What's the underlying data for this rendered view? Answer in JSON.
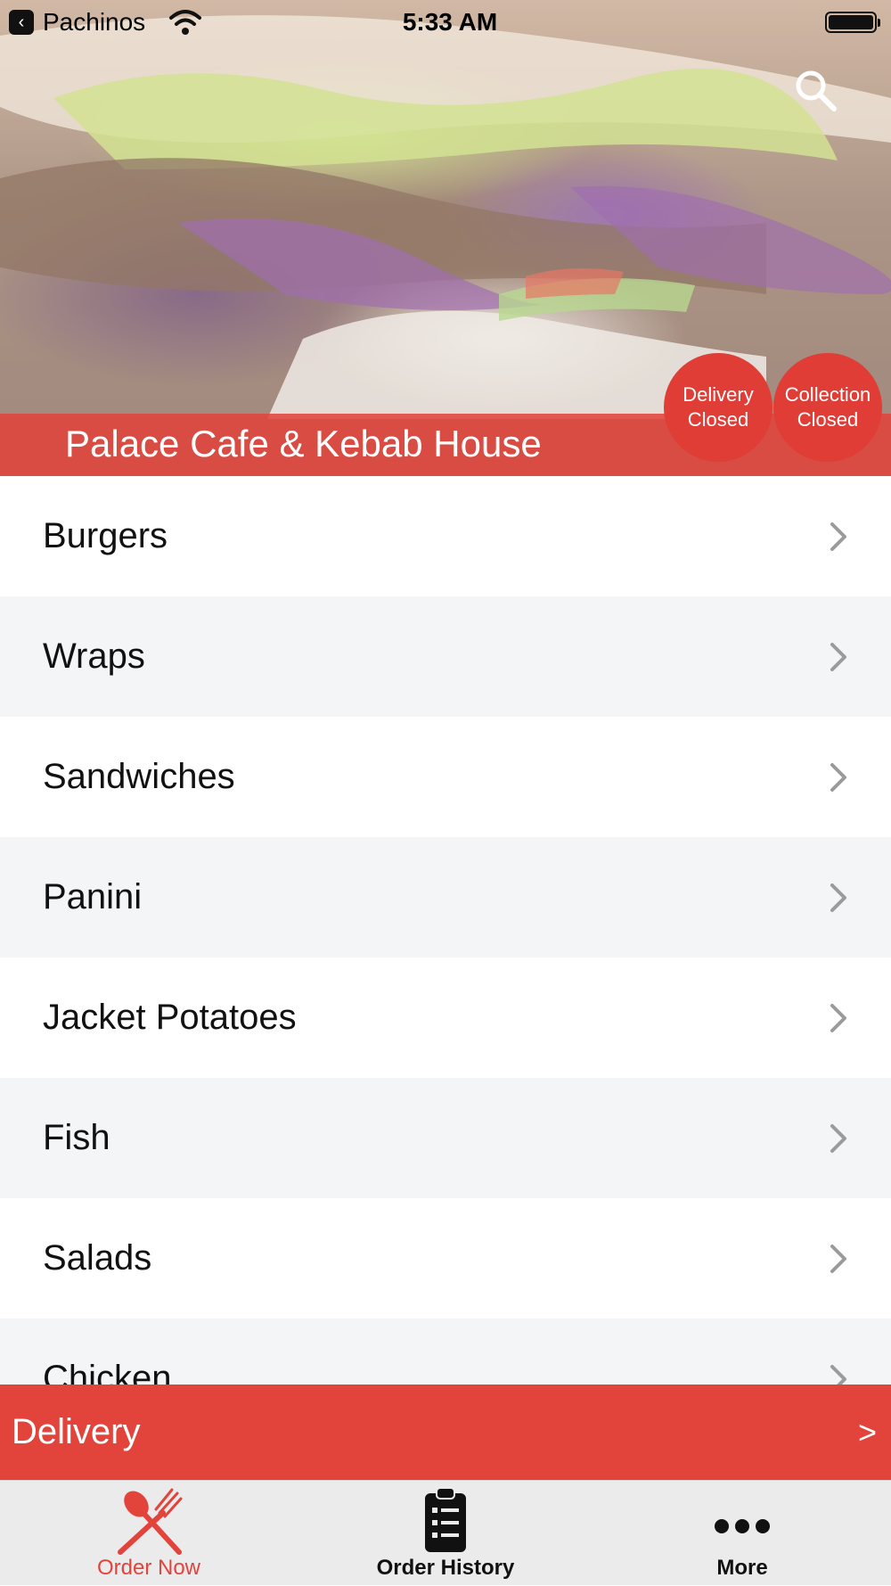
{
  "status_bar": {
    "back_app": "Pachinos",
    "time": "5:33 AM"
  },
  "header": {
    "restaurant_name": "Palace Cafe & Kebab House",
    "delivery_status_line1": "Delivery",
    "delivery_status_line2": "Closed",
    "collection_status_line1": "Collection",
    "collection_status_line2": "Closed",
    "search_icon": "search-icon"
  },
  "menu": {
    "categories": [
      {
        "label": "Burgers"
      },
      {
        "label": "Wraps"
      },
      {
        "label": "Sandwiches"
      },
      {
        "label": "Panini"
      },
      {
        "label": "Jacket Potatoes"
      },
      {
        "label": "Fish"
      },
      {
        "label": "Salads"
      },
      {
        "label": "Chicken"
      }
    ]
  },
  "order_mode_bar": {
    "label": "Delivery",
    "arrow": ">"
  },
  "tab_bar": {
    "tabs": [
      {
        "label": "Order Now",
        "icon": "fork-knife-icon",
        "active": true
      },
      {
        "label": "Order History",
        "icon": "clipboard-list-icon",
        "active": false
      },
      {
        "label": "More",
        "icon": "more-dots-icon",
        "active": false
      }
    ]
  },
  "colors": {
    "accent": "#e2433b",
    "active_tab": "#e2433b",
    "row_alt": "#f4f5f7"
  }
}
